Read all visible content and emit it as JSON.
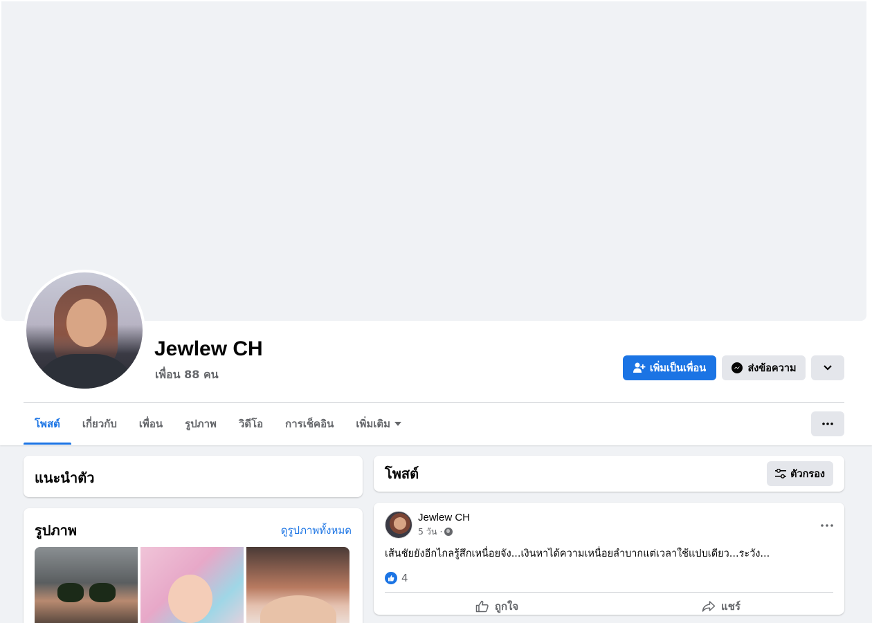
{
  "profile": {
    "name": "Jewlew CH",
    "friends_label": "เพื่อน 88 คน"
  },
  "actions": {
    "add_friend_label": "เพิ่มเป็นเพื่อน",
    "message_label": "ส่งข้อความ"
  },
  "tabs": [
    {
      "label": "โพสต์",
      "active": true
    },
    {
      "label": "เกี่ยวกับ",
      "active": false
    },
    {
      "label": "เพื่อน",
      "active": false
    },
    {
      "label": "รูปภาพ",
      "active": false
    },
    {
      "label": "วิดีโอ",
      "active": false
    },
    {
      "label": "การเช็คอิน",
      "active": false
    },
    {
      "label": "เพิ่มเติม",
      "active": false
    }
  ],
  "intro": {
    "title": "แนะนำตัว"
  },
  "photos": {
    "title": "รูปภาพ",
    "see_all_label": "ดูรูปภาพทั้งหมด"
  },
  "posts_section": {
    "title": "โพสต์",
    "filter_label": "ตัวกรอง"
  },
  "post": {
    "author": "Jewlew CH",
    "time": "5 วัน ·",
    "text": "เส้นชัยยังอีกไกลรู้สึกเหนื่อยจัง...เงินหาได้ความเหนื่อยลำบากแต่เวลาใช้แปบเดียว...ระวัง...",
    "reaction_count": "4",
    "like_label": "ถูกใจ",
    "share_label": "แชร์"
  },
  "colors": {
    "accent": "#1b74e4",
    "page_bg": "#f0f2f5",
    "secondary_btn": "#e4e6eb",
    "muted_text": "#65676b"
  }
}
